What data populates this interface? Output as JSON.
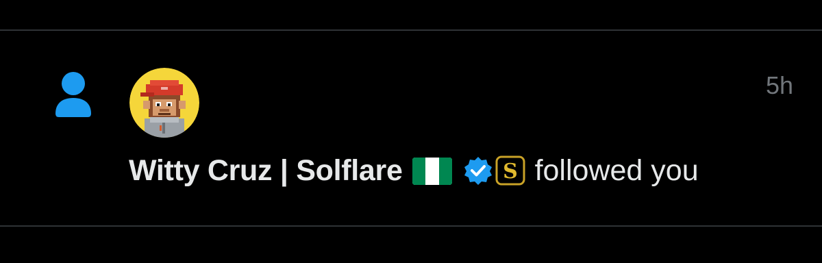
{
  "notification": {
    "type_icon": "person-icon",
    "avatar": {
      "icon": "pixel-monkey-avatar",
      "background_color": "#f5d63a"
    },
    "timestamp": "5h",
    "user": {
      "display_name": "Witty Cruz | Solflare",
      "flag_icon": "nigeria-flag-icon",
      "verified_icon": "verified-badge-icon",
      "affiliate_icon": "affiliate-badge-icon"
    },
    "action_text": "followed you"
  },
  "colors": {
    "background": "#000000",
    "divider": "#2f3336",
    "primary_text": "#e7e9ea",
    "secondary_text": "#71767b",
    "accent": "#1d9bf0",
    "nigeria_green": "#008751"
  }
}
